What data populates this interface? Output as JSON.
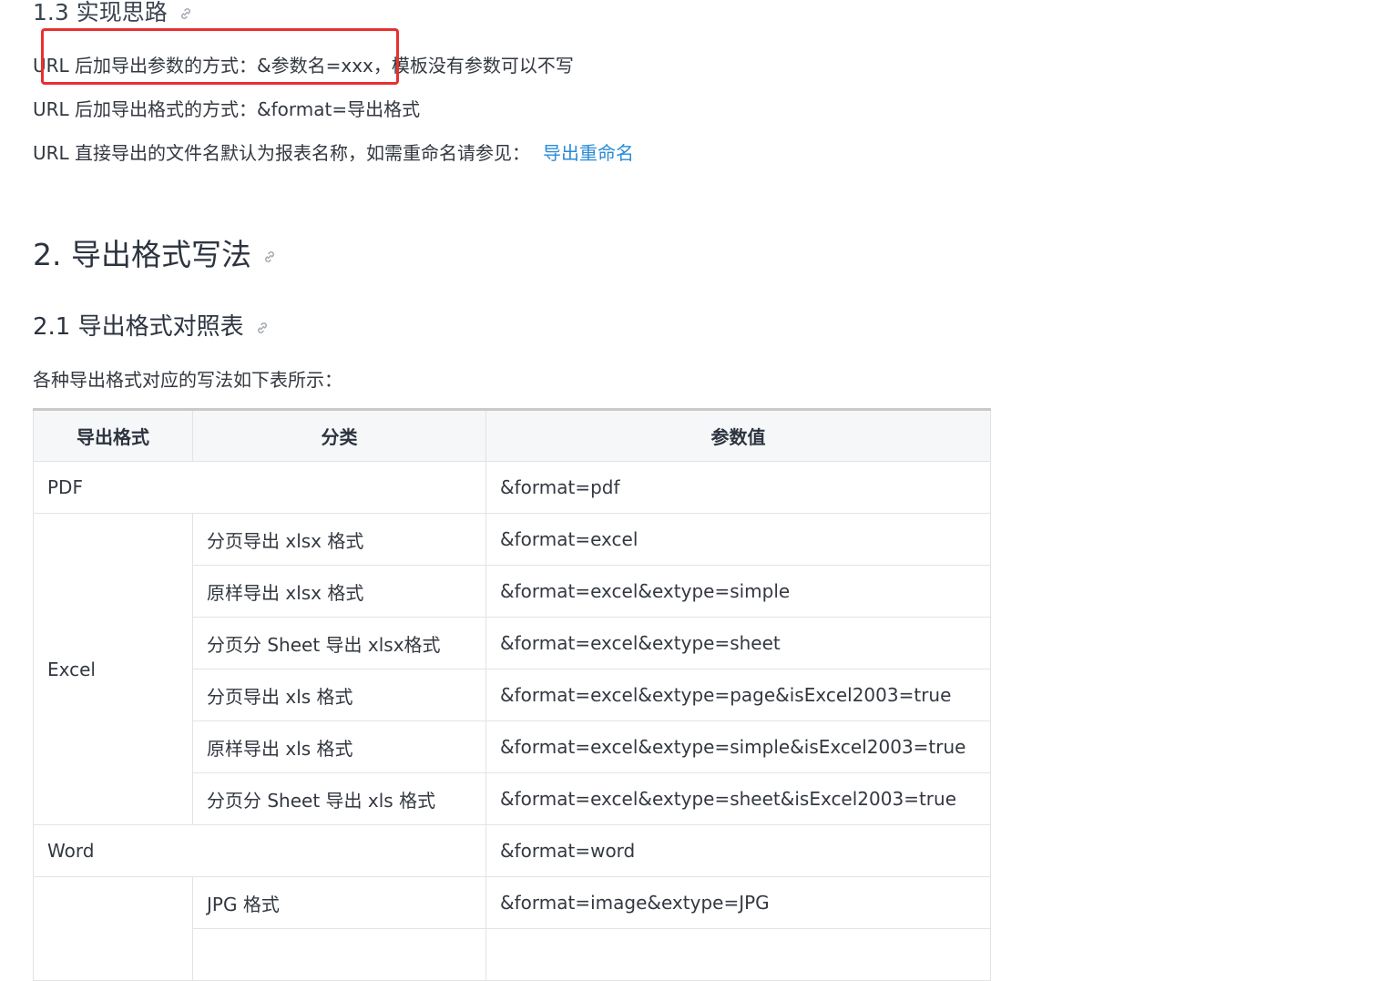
{
  "section_1_3": {
    "title": "1.3 实现思路"
  },
  "paragraphs": {
    "p1": "URL 后加导出参数的方式：&参数名=xxx，模板没有参数可以不写",
    "p2": "URL 后加导出格式的方式：&format=导出格式",
    "p3_text": "URL 直接导出的文件名默认为报表名称，如需重命名请参见：",
    "p3_link": "导出重命名"
  },
  "section_2": {
    "title": "2. 导出格式写法"
  },
  "section_2_1": {
    "title": "2.1 导出格式对照表",
    "intro": "各种导出格式对应的写法如下表所示："
  },
  "table": {
    "headers": [
      "导出格式",
      "分类",
      "参数值"
    ],
    "pdf": {
      "format": "PDF",
      "value": "&format=pdf"
    },
    "excel": {
      "format": "Excel",
      "rows": [
        {
          "category": "分页导出 xlsx 格式",
          "value": "&format=excel"
        },
        {
          "category": "原样导出 xlsx 格式",
          "value": "&format=excel&extype=simple"
        },
        {
          "category": "分页分 Sheet 导出 xlsx格式",
          "value": "&format=excel&extype=sheet"
        },
        {
          "category": "分页导出 xls 格式",
          "value": "&format=excel&extype=page&isExcel2003=true"
        },
        {
          "category": "原样导出 xls 格式",
          "value": "&format=excel&extype=simple&isExcel2003=true"
        },
        {
          "category": "分页分 Sheet 导出 xls 格式",
          "value": "&format=excel&extype=sheet&isExcel2003=true"
        }
      ]
    },
    "word": {
      "format": "Word",
      "value": "&format=word"
    },
    "image": {
      "rows": [
        {
          "category": "JPG 格式",
          "value": "&format=image&extype=JPG"
        }
      ]
    }
  },
  "colors": {
    "link": "#2a8bd6",
    "highlight_border": "#e83030",
    "header_bg": "#f6f7f8"
  }
}
